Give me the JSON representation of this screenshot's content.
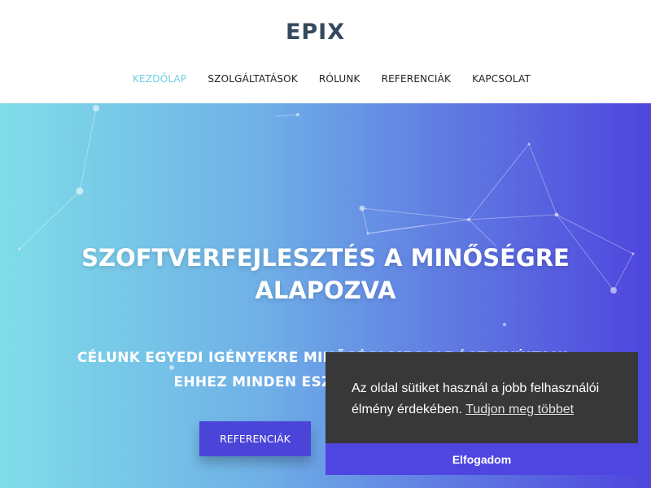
{
  "header": {
    "logo": "EPIX",
    "nav": [
      {
        "label": "KEZDŐLAP",
        "active": true
      },
      {
        "label": "SZOLGÁLTATÁSOK",
        "active": false
      },
      {
        "label": "RÓLUNK",
        "active": false
      },
      {
        "label": "REFERENCIÁK",
        "active": false
      },
      {
        "label": "KAPCSOLAT",
        "active": false
      }
    ]
  },
  "hero": {
    "title_line1": "SZOFTVERFEJLESZTÉS A MINŐSÉGRE",
    "title_line2": "ALAPOZVA",
    "subtitle_line1": "CÉLUNK EGYEDI IGÉNYEKRE MINŐSÉGI MEGOLDÁST NYÚJTANI,",
    "subtitle_line2": "EHHEZ MINDEN ESZKÖZÜNK MEGVAN.",
    "button_label": "REFERENCIÁK",
    "gradient_colors": [
      "#7fdde9",
      "#4e45dd"
    ]
  },
  "cookie_banner": {
    "message": "Az oldal sütiket használ a jobb felhasználói élmény érdekében.",
    "learn_more": "Tudjon meg többet",
    "accept_label": "Elfogadom",
    "background_color": "#383838",
    "accept_color": "#4f46e1"
  },
  "colors": {
    "logo": "#34495e",
    "nav_active": "#6fcfe6",
    "button": "#4a44d8"
  }
}
